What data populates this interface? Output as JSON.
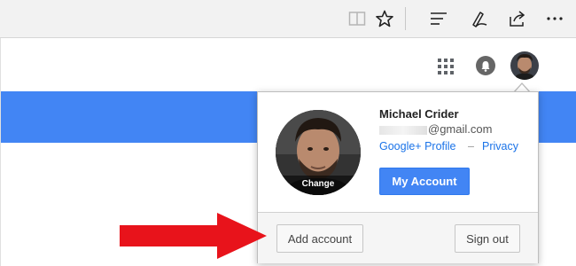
{
  "browser_toolbar": {
    "icons": [
      "reading-view-icon",
      "favorite-star-icon",
      "hub-icon",
      "web-note-icon",
      "share-icon",
      "more-icon"
    ]
  },
  "google_bar": {
    "icons": [
      "apps-grid-icon",
      "notifications-bell-icon",
      "account-avatar-icon"
    ]
  },
  "account_popup": {
    "name": "Michael Crider",
    "email": "@gmail.com",
    "profile_link": "Google+ Profile",
    "separator": "–",
    "privacy_link": "Privacy",
    "photo_label": "Change",
    "my_account_button": "My Account",
    "add_account_button": "Add account",
    "sign_out_button": "Sign out"
  },
  "colors": {
    "brand_blue": "#4285f4",
    "link_blue": "#1a73e8",
    "arrow_red": "#e8131b"
  }
}
